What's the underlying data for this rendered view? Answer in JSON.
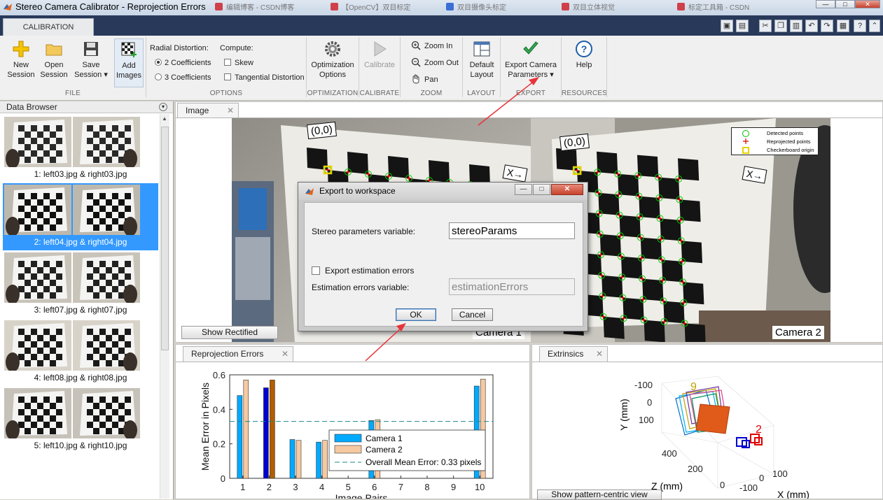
{
  "window": {
    "title": "Stereo Camera Calibrator - Reprojection Errors",
    "browser_tabs": [
      {
        "label": "编辑博客 - CSDN博客",
        "color": "red"
      },
      {
        "label": "【OpenCV】双目标定",
        "color": "red"
      },
      {
        "label": "双目摄像头标定",
        "color": "blue"
      },
      {
        "label": "双目立体视觉",
        "color": "red"
      },
      {
        "label": "标定工具箱 - CSDN",
        "color": "red"
      }
    ],
    "controls": {
      "minimize": "—",
      "maximize": "□",
      "close": "✕"
    }
  },
  "ribbon": {
    "tab": "CALIBRATION",
    "file": {
      "new_session": "New\nSession",
      "open_session": "Open\nSession",
      "save_session": "Save\nSession ▾",
      "add_images": "Add\nImages",
      "section": "FILE"
    },
    "options": {
      "radial_label": "Radial Distortion:",
      "compute_label": "Compute:",
      "two_coeff": "2 Coefficients",
      "three_coeff": "3 Coefficients",
      "skew": "Skew",
      "tangential": "Tangential Distortion",
      "section": "OPTIONS"
    },
    "optimization": {
      "label": "Optimization\nOptions",
      "section": "OPTIMIZATION"
    },
    "calibrate": {
      "label": "Calibrate",
      "section": "CALIBRATE"
    },
    "zoom": {
      "zoom_in": "Zoom In",
      "zoom_out": "Zoom Out",
      "pan": "Pan",
      "section": "ZOOM"
    },
    "layout": {
      "label": "Default\nLayout",
      "section": "LAYOUT"
    },
    "export": {
      "label": "Export Camera\nParameters ▾",
      "section": "EXPORT"
    },
    "resources": {
      "label": "Help",
      "section": "RESOURCES"
    }
  },
  "data_browser": {
    "title": "Data Browser",
    "items": [
      {
        "label": "1: left03.jpg & right03.jpg",
        "selected": false
      },
      {
        "label": "2: left04.jpg & right04.jpg",
        "selected": true
      },
      {
        "label": "3: left07.jpg & right07.jpg",
        "selected": false
      },
      {
        "label": "4: left08.jpg & right08.jpg",
        "selected": false
      },
      {
        "label": "5: left10.jpg & right10.jpg",
        "selected": false
      }
    ]
  },
  "image_panel": {
    "tab": "Image",
    "origin_label": "(0,0)",
    "x_label": "X→",
    "camera1": "Camera 1",
    "camera2": "Camera 2",
    "show_rectified": "Show Rectified",
    "legend": {
      "detected": "Detected points",
      "reprojected": "Reprojected points",
      "origin": "Checkerboard origin"
    }
  },
  "dialog": {
    "title": "Export to workspace",
    "stereo_label": "Stereo parameters variable:",
    "stereo_value": "stereoParams",
    "export_errors": "Export estimation errors",
    "errors_label": "Estimation errors variable:",
    "errors_value": "estimationErrors",
    "ok": "OK",
    "cancel": "Cancel"
  },
  "reprojection_panel": {
    "tab": "Reprojection Errors",
    "chart_data": {
      "type": "bar",
      "categories": [
        "1",
        "2",
        "3",
        "4",
        "5",
        "6",
        "7",
        "8",
        "9",
        "10"
      ],
      "series": [
        {
          "name": "Camera 1",
          "values": [
            0.48,
            0.525,
            0.225,
            0.21,
            null,
            0.335,
            null,
            null,
            null,
            0.535
          ]
        },
        {
          "name": "Camera 2",
          "values": [
            0.57,
            0.57,
            0.22,
            0.22,
            null,
            0.34,
            null,
            null,
            null,
            0.575
          ]
        }
      ],
      "overall_mean": 0.33,
      "overall_label": "Overall Mean Error: 0.33 pixels",
      "ylabel": "Mean Error in Pixels",
      "xlabel": "Image Pairs",
      "ylim": [
        0,
        0.6
      ],
      "yticks": [
        "0",
        "0.2",
        "0.4",
        "0.6"
      ],
      "selected_category": "2",
      "colors": {
        "camera1": "#00aaff",
        "camera2": "#f5c9a1",
        "camera1_sel": "#0000cc",
        "camera2_sel": "#b35c00",
        "mean": "#1a8a8a"
      }
    }
  },
  "extrinsics_panel": {
    "tab": "Extrinsics",
    "y_label": "Y (mm)",
    "z_label": "Z (mm)",
    "x_label": "X (mm)",
    "y_ticks": [
      "-100",
      "0",
      "100"
    ],
    "z_ticks": [
      "400",
      "200",
      "0"
    ],
    "x_ticks": [
      "-100",
      "0",
      "100"
    ],
    "show_pattern": "Show pattern-centric view"
  }
}
